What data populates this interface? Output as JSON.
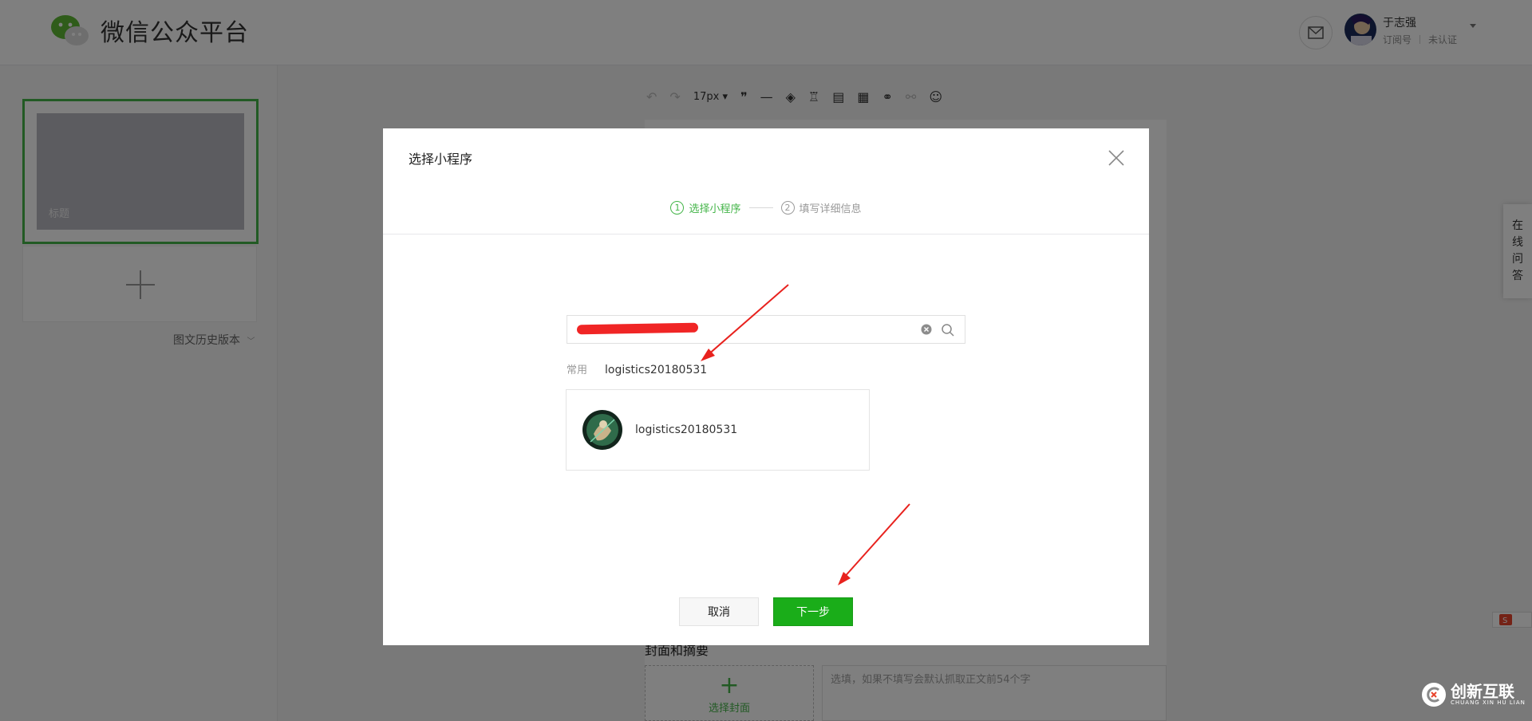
{
  "header": {
    "app_title": "微信公众平台",
    "user_name": "于志强",
    "account_type": "订阅号",
    "verify_status": "未认证"
  },
  "left_panel": {
    "article_title": "标题",
    "history_label": "图文历史版本"
  },
  "editor": {
    "font_size": "17px",
    "cover_heading": "封面和摘要",
    "choose_cover_label": "选择封面",
    "summary_placeholder": "选填，如果不填写会默认抓取正文前54个字"
  },
  "side": {
    "qa_chars": [
      "在",
      "线",
      "问",
      "答"
    ]
  },
  "modal": {
    "title": "选择小程序",
    "steps": [
      {
        "num": "1",
        "label": "选择小程序",
        "active": true
      },
      {
        "num": "2",
        "label": "填写详细信息",
        "active": false
      }
    ],
    "search_value": "",
    "common_label": "常用",
    "common_item": "logistics20180531",
    "result_name": "logistics20180531",
    "cancel_label": "取消",
    "next_label": "下一步"
  },
  "watermark": {
    "text": "创新互联",
    "sub": "CHUANG XIN HU LIAN"
  },
  "colors": {
    "brand_green": "#44b549",
    "button_green": "#1aad19",
    "annotation_red": "#e8221e"
  }
}
